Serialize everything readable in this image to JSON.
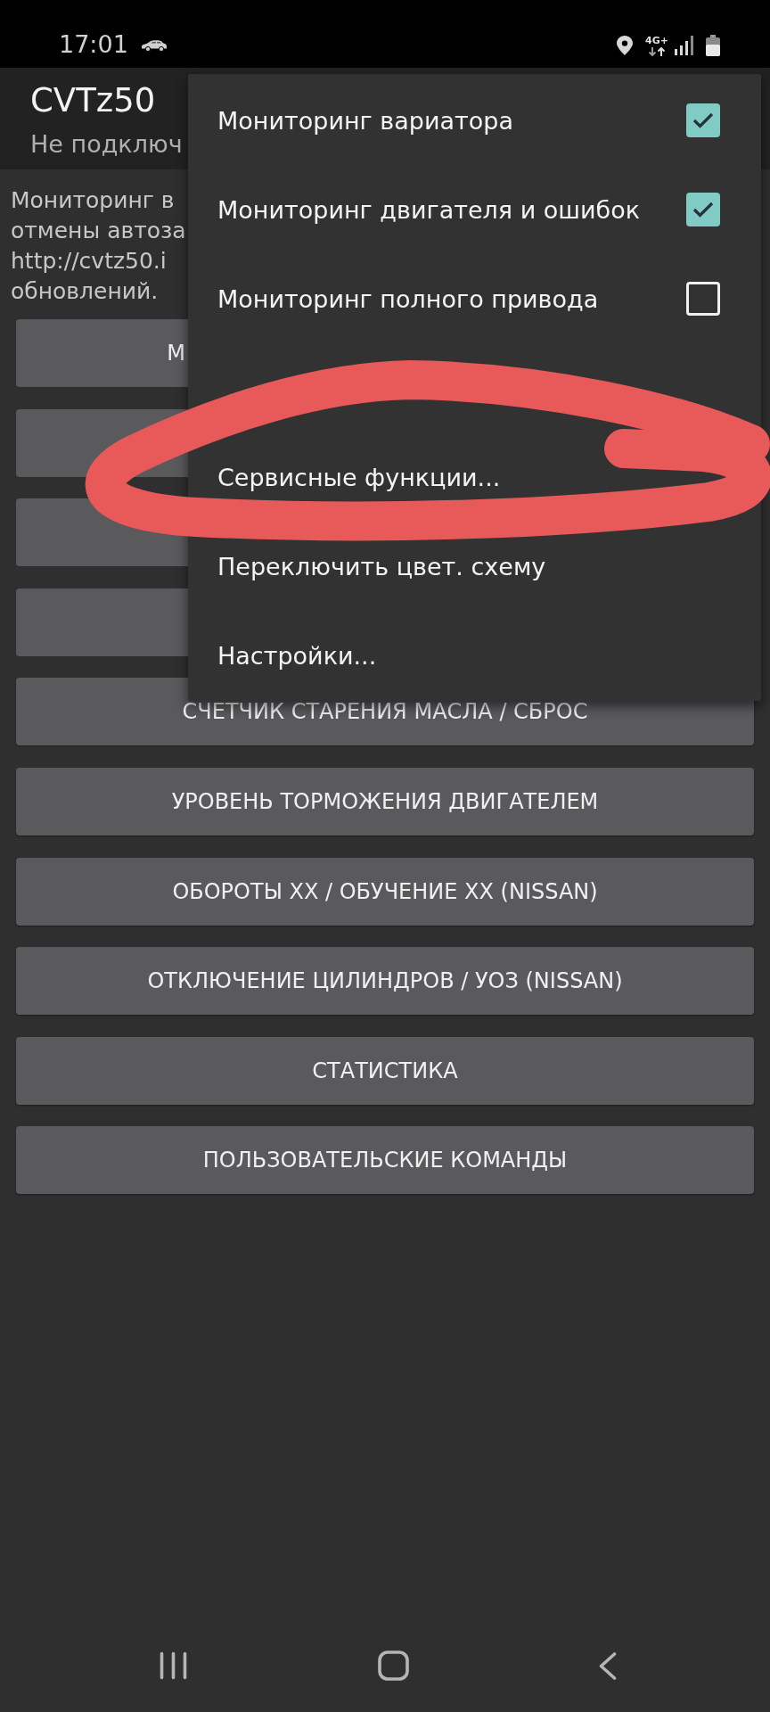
{
  "status_bar": {
    "time": "17:01",
    "network": "4G+"
  },
  "app_bar": {
    "title": "CVTz50",
    "subtitle": "Не подключ"
  },
  "description_lines": [
    "Мониторинг в",
    "отмены автоза",
    "http://cvtz50.i",
    "обновлений."
  ],
  "buttons": [
    {
      "label": "М",
      "covered": true
    },
    {
      "covered": true
    },
    {
      "covered": true
    },
    {
      "covered": true
    },
    {
      "label": "СЧЕТЧИК СТАРЕНИЯ МАСЛА / СБРОС",
      "covered": false
    },
    {
      "label": "УРОВЕНЬ ТОРМОЖЕНИЯ ДВИГАТЕЛЕМ",
      "covered": false
    },
    {
      "label": "ОБОРОТЫ ХХ / ОБУЧЕНИЕ ХХ (NISSAN)",
      "covered": false
    },
    {
      "label": "ОТКЛЮЧЕНИЕ ЦИЛИНДРОВ / УОЗ (NISSAN)",
      "covered": false
    },
    {
      "label": "СТАТИСТИКА",
      "covered": false
    },
    {
      "label": "ПОЛЬЗОВАТЕЛЬСКИЕ КОМАНДЫ",
      "covered": false
    }
  ],
  "menu": {
    "items": [
      {
        "kind": "checkbox",
        "label": "Мониторинг вариатора",
        "checked": true
      },
      {
        "kind": "checkbox",
        "label": "Мониторинг двигателя и ошибок",
        "checked": true
      },
      {
        "kind": "checkbox",
        "label": "Мониторинг полного привода",
        "checked": false
      },
      {
        "kind": "action",
        "label": "Сервисные функции..."
      },
      {
        "kind": "action",
        "label": "Переключить цвет. схему"
      },
      {
        "kind": "action",
        "label": "Настройки..."
      }
    ]
  },
  "annotations": [
    {
      "kind": "scribble"
    }
  ]
}
